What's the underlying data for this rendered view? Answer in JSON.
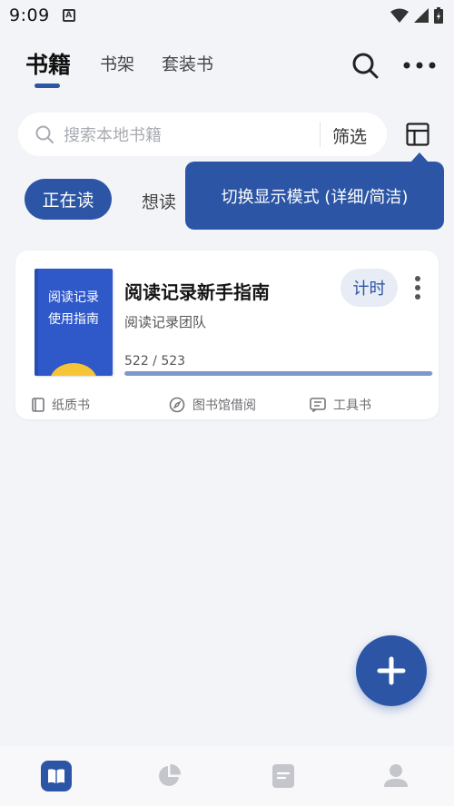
{
  "status_bar": {
    "time": "9:09",
    "notification_icon": "a-icon"
  },
  "header": {
    "tabs": [
      {
        "label": "书籍",
        "active": true
      },
      {
        "label": "书架",
        "active": false
      },
      {
        "label": "套装书",
        "active": false
      }
    ]
  },
  "search": {
    "placeholder": "搜索本地书籍",
    "filter_label": "筛选"
  },
  "tooltip": {
    "text": "切换显示模式 (详细/简洁)"
  },
  "filters": [
    {
      "label": "正在读",
      "active": true
    },
    {
      "label": "想读",
      "active": false
    }
  ],
  "book": {
    "cover_text": "阅读记录\n使用指南",
    "title": "阅读记录新手指南",
    "author": "阅读记录团队",
    "timer_label": "计时",
    "progress_text": "522 / 523",
    "progress_fraction": 0.998,
    "tags": [
      {
        "label": "纸质书",
        "icon": "book-icon"
      },
      {
        "label": "图书馆借阅",
        "icon": "compass-icon"
      },
      {
        "label": "工具书",
        "icon": "notes-icon"
      }
    ]
  },
  "bottom_nav": [
    {
      "icon": "book-open-icon",
      "active": true
    },
    {
      "icon": "pie-chart-icon",
      "active": false
    },
    {
      "icon": "notes-icon",
      "active": false
    },
    {
      "icon": "user-icon",
      "active": false
    }
  ],
  "colors": {
    "accent": "#2c56a5",
    "background": "#f3f4f8"
  }
}
